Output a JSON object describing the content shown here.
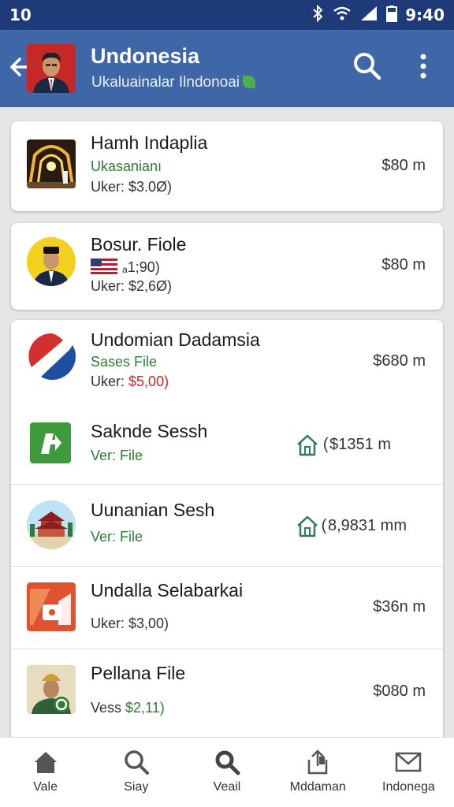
{
  "status_bar": {
    "left": "10",
    "time": "9:40"
  },
  "header": {
    "title": "Undonesia",
    "subtitle": "Ukaluainalar Ilndonoai"
  },
  "cards": [
    {
      "title": "Hamh Indaplia",
      "line2": "Ukasanianı",
      "line3": "Uker: $3.0Ø)",
      "price": "$80 m",
      "thumb": "festival-photo"
    },
    {
      "title": "Bosur. Fiole",
      "line2": "ₐ1;90)",
      "line3": "Uker: $2,6Ø)",
      "price": "$80 m",
      "thumb": "person-photo"
    }
  ],
  "list": [
    {
      "title": "Undomian Dadamsia",
      "line2": "Sases File",
      "line3_label": "Uker:",
      "line3_value": "$5,00)",
      "price": "$680 m",
      "thumb": "logo-circle"
    },
    {
      "title": "Saknde Sessh",
      "line2": "Ver: File",
      "price": "( $1351 m",
      "thumb": "green-app-icon",
      "has_home_icon": true
    },
    {
      "title": "Uunanian Sesh",
      "line2": "Ver: File",
      "price": "( 8,9831 mm",
      "thumb": "temple-photo",
      "has_home_icon": true
    },
    {
      "title": "Undalla Selabarkai",
      "line3": "Uker: $3,00)",
      "price": "$36n m",
      "thumb": "orange-app-icon"
    },
    {
      "title": "Pellana File",
      "line3_label": "Vess",
      "line3_value": "$2,11)",
      "price": "$080 m",
      "thumb": "costume-photo"
    }
  ],
  "bottom_nav": [
    {
      "label": "Vale",
      "icon": "home-icon"
    },
    {
      "label": "Siay",
      "icon": "search-icon"
    },
    {
      "label": "Veail",
      "icon": "search-icon"
    },
    {
      "label": "Mddaman",
      "icon": "share-icon"
    },
    {
      "label": "Indonega",
      "icon": "mail-icon"
    }
  ],
  "colors": {
    "status_bar": "#1f3a78",
    "app_bar": "#3f67a8",
    "accent_green": "#2e7d32",
    "accent_red": "#c62828"
  }
}
